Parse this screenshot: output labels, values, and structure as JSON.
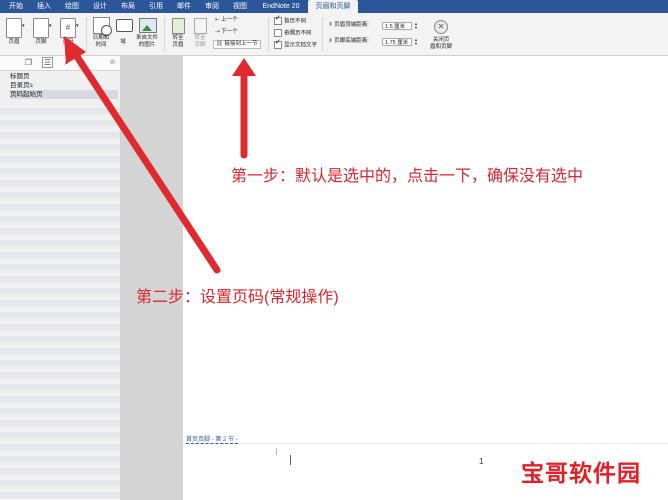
{
  "ribbon_tabs": [
    "开始",
    "插入",
    "绘图",
    "设计",
    "布局",
    "引用",
    "邮件",
    "审阅",
    "视图",
    "EndNote 20",
    "页眉和页脚"
  ],
  "ribbon": {
    "header_btn": "页眉",
    "footer_btn": "页脚",
    "page_number_btn": "页码",
    "datetime_btn_line1": "日期和",
    "datetime_btn_line2": "时间",
    "field_btn": "域",
    "picture_btn_line1": "来自文件",
    "picture_btn_line2": "的图片",
    "goto_header_line1": "转至",
    "goto_header_line2": "页眉",
    "goto_footer_line1": "转至",
    "goto_footer_line2": "页脚",
    "prev_btn": "上一个",
    "next_btn": "下一个",
    "link_prev_btn": "链接到上一节",
    "opt_diff_first": "首页不同",
    "opt_diff_odd_even": "奇偶页不同",
    "opt_show_text": "显示文档文字",
    "header_top_label": "页眉顶端距离:",
    "header_top_value": "1.5 厘米",
    "footer_bottom_label": "页脚底端距离:",
    "footer_bottom_value": "1.75 厘米",
    "close_line1": "关闭页",
    "close_line2": "眉和页脚"
  },
  "nav": {
    "items": [
      "标题页",
      "目录页s",
      "页码起始页"
    ]
  },
  "document": {
    "footer_tag": "首页页脚 - 第 2 节 -",
    "page_number": "1"
  },
  "annotations": {
    "step1": "第一步：默认是选中的，点击一下，确保没有选中",
    "step2": "第二步：设置页码(常规操作)"
  },
  "watermark": {
    "text": "宝哥软件园"
  },
  "colors": {
    "ribbon_blue": "#2b579a",
    "annotation_red": "#d9272e"
  }
}
